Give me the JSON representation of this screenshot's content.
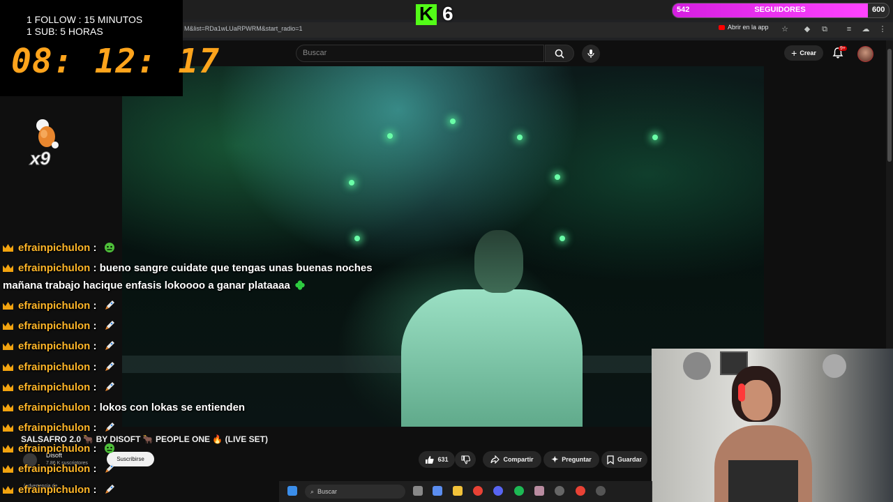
{
  "overlay": {
    "follow_text": "1 FOLLOW : 15 MINUTOS",
    "sub_text": "1 SUB: 5 HORAS",
    "countdown": "08: 12: 17",
    "combo_count": "x9",
    "kick_count": "6",
    "goal": {
      "current": "542",
      "label": "SEGUIDORES",
      "target": "600",
      "progress": 0.9033,
      "color": "#d41ee0"
    }
  },
  "browser": {
    "url": "M&list=RDa1wLUaRPWRM&start_radio=1",
    "open_in_app": "Abrir en la app"
  },
  "youtube": {
    "search_placeholder": "Buscar",
    "create_label": "Crear",
    "notifications_badge": "9+",
    "video_title": "SALSAFRO 2.0 🐂 BY DISOFT 🐂 PEOPLE ONE 🔥 (LIVE SET)",
    "channel_name": "Disoft",
    "channel_subs": "7.86 K suscriptores",
    "subscribe_label": "Suscribirse",
    "like_count": "631",
    "share_label": "Compartir",
    "ask_label": "Preguntar",
    "save_label": "Guardar",
    "description_snippet": "(advertencia de"
  },
  "chat": [
    {
      "user": "efrainpichulon",
      "message": "",
      "emote": "hulk"
    },
    {
      "user": "efrainpichulon",
      "message": "bueno sangre cuidate que tengas unas buenas noches",
      "emote": ""
    },
    {
      "user": "",
      "message": "mañana trabajo hacique enfasis lokoooo a ganar plataaaa",
      "emote": "clover"
    },
    {
      "user": "efrainpichulon",
      "message": "",
      "emote": "rocket"
    },
    {
      "user": "efrainpichulon",
      "message": "",
      "emote": "rocket"
    },
    {
      "user": "efrainpichulon",
      "message": "",
      "emote": "rocket"
    },
    {
      "user": "efrainpichulon",
      "message": "",
      "emote": "rocket"
    },
    {
      "user": "efrainpichulon",
      "message": "",
      "emote": "rocket"
    },
    {
      "user": "efrainpichulon",
      "message": "lokos con lokas se entienden",
      "emote": ""
    },
    {
      "user": "efrainpichulon",
      "message": "",
      "emote": "rocket"
    },
    {
      "user": "efrainpichulon",
      "message": "",
      "emote": "hulk"
    },
    {
      "user": "efrainpichulon",
      "message": "",
      "emote": "rocket"
    },
    {
      "user": "efrainpichulon",
      "message": "",
      "emote": "rocket"
    }
  ],
  "taskbar": {
    "search_label": "Buscar"
  },
  "colors": {
    "kick_green": "#53fc18",
    "timer_orange": "#ffa41c",
    "chat_username": "#ffb628",
    "crown": "#f2a30f"
  }
}
